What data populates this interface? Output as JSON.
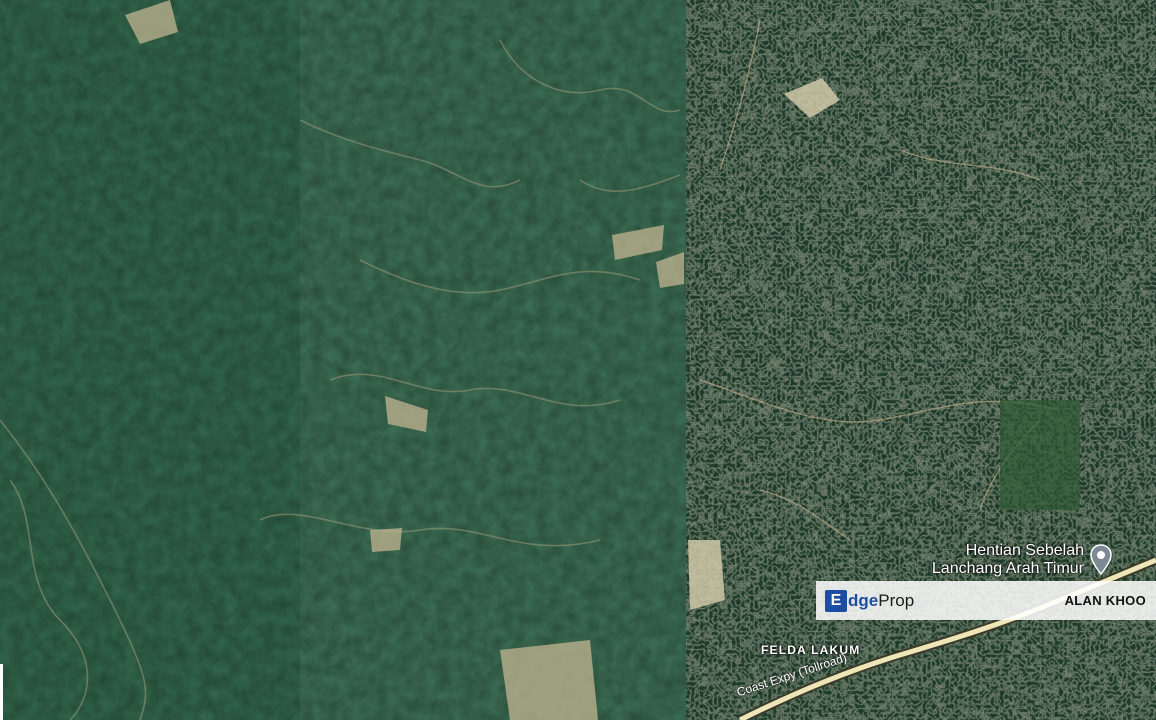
{
  "map": {
    "poi_label_line1": "Hentian Sebelah",
    "poi_label_line2": "Lanchang Arah Timur",
    "area_label": "FELDA LAKUM",
    "road_label": "Coast Expy (Tollroad)"
  },
  "watermark": {
    "logo_initial": "E",
    "logo_text_a": "dge",
    "logo_text_b": "Prop",
    "agent_name": "ALAN KHOO"
  },
  "colors": {
    "left_tint": "#3e7257",
    "right_forest": "#1e3b2a",
    "road": "#efe6b8",
    "logo_blue": "#1b4ea0"
  }
}
